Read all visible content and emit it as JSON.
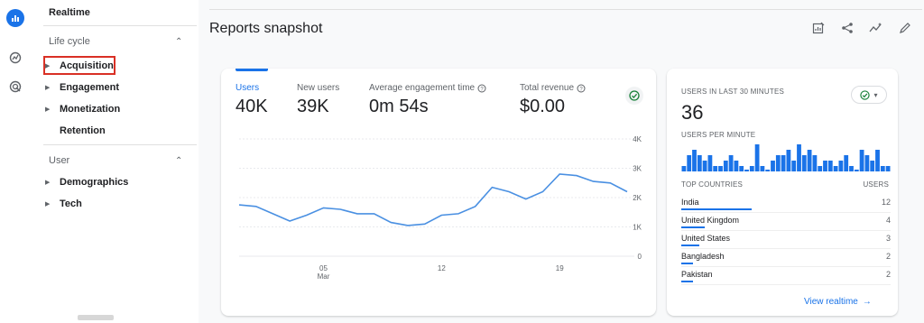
{
  "sidebar": {
    "realtime_label": "Realtime",
    "lifecycle": {
      "header": "Life cycle",
      "items": [
        {
          "label": "Acquisition"
        },
        {
          "label": "Engagement"
        },
        {
          "label": "Monetization"
        },
        {
          "label": "Retention"
        }
      ]
    },
    "user": {
      "header": "User",
      "items": [
        {
          "label": "Demographics"
        },
        {
          "label": "Tech"
        }
      ]
    }
  },
  "header": {
    "title": "Reports snapshot"
  },
  "metrics": [
    {
      "label": "Users",
      "value": "40K"
    },
    {
      "label": "New users",
      "value": "39K"
    },
    {
      "label": "Average engagement time",
      "value": "0m 54s"
    },
    {
      "label": "Total revenue",
      "value": "$0.00"
    }
  ],
  "chart_data": {
    "type": "line",
    "series": [
      {
        "values": [
          1750,
          1700,
          1450,
          1200,
          1400,
          1650,
          1600,
          1450,
          1450,
          1150,
          1050,
          1100,
          1400,
          1450,
          1700,
          2350,
          2200,
          1950,
          2200,
          2800,
          2750,
          2550,
          2500,
          2200
        ]
      }
    ],
    "x_tick_labels": [
      {
        "index": 5,
        "line1": "05",
        "line2": "Mar"
      },
      {
        "index": 12,
        "line1": "12",
        "line2": ""
      },
      {
        "index": 19,
        "line1": "19",
        "line2": ""
      }
    ],
    "y_ticks": [
      "4K",
      "3K",
      "2K",
      "1K",
      "0"
    ],
    "ylim": [
      0,
      4000
    ],
    "colors": {
      "line": "#4a90e2",
      "grid": "#e8eaed"
    }
  },
  "realtime": {
    "users_label": "USERS IN LAST 30 MINUTES",
    "users_count": "36",
    "per_minute_label": "USERS PER MINUTE",
    "per_minute_values": [
      1,
      3,
      4,
      3,
      2,
      3,
      1,
      1,
      2,
      3,
      2,
      1,
      0,
      1,
      5,
      1,
      0,
      2,
      3,
      3,
      4,
      2,
      5,
      3,
      4,
      3,
      1,
      2,
      2,
      1,
      2,
      3,
      1,
      0,
      4,
      3,
      2,
      4,
      1,
      1
    ],
    "top_countries_label": "TOP COUNTRIES",
    "users_col_label": "USERS",
    "countries": [
      {
        "name": "India",
        "users": "12",
        "share": 1.0
      },
      {
        "name": "United Kingdom",
        "users": "4",
        "share": 0.33
      },
      {
        "name": "United States",
        "users": "3",
        "share": 0.25
      },
      {
        "name": "Bangladesh",
        "users": "2",
        "share": 0.17
      },
      {
        "name": "Pakistan",
        "users": "2",
        "share": 0.17
      }
    ],
    "view_link": "View realtime"
  },
  "colors": {
    "accent": "#1a73e8",
    "highlight": "#d93025"
  }
}
